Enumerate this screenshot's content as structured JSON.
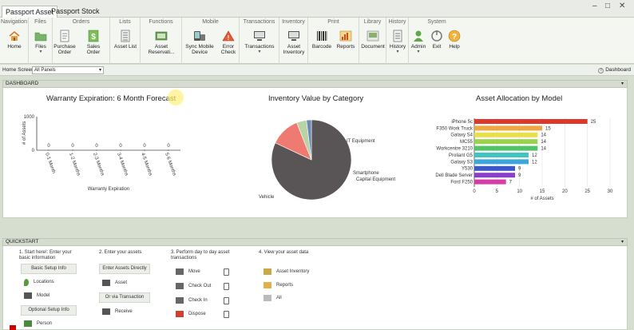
{
  "app_tabs": [
    "Passport Asset",
    "Passport Stock"
  ],
  "window_controls": [
    "–",
    "□",
    "✕"
  ],
  "ribbon": {
    "groups": [
      {
        "title": "Navigation",
        "buttons": [
          {
            "label": "Home",
            "icon": "home-icon"
          }
        ]
      },
      {
        "title": "Files",
        "buttons": [
          {
            "label": "Files",
            "icon": "folder-icon",
            "dropdown": true
          }
        ]
      },
      {
        "title": "Orders",
        "buttons": [
          {
            "label": "Purchase Order",
            "icon": "purchase-order-icon"
          },
          {
            "label": "Sales Order",
            "icon": "dollar-icon"
          }
        ]
      },
      {
        "title": "Lists",
        "buttons": [
          {
            "label": "Asset List",
            "icon": "list-icon"
          }
        ]
      },
      {
        "title": "Functions",
        "buttons": [
          {
            "label": "Asset Reservati...",
            "icon": "reservation-icon"
          }
        ]
      },
      {
        "title": "Mobile",
        "buttons": [
          {
            "label": "Sync Mobile Device",
            "icon": "sync-icon"
          },
          {
            "label": "Error Check",
            "icon": "error-icon"
          }
        ]
      },
      {
        "title": "Transactions",
        "buttons": [
          {
            "label": "Transactions",
            "icon": "monitor-icon",
            "dropdown": true
          }
        ]
      },
      {
        "title": "Inventory",
        "buttons": [
          {
            "label": "Asset Inventory",
            "icon": "monitor-icon"
          }
        ]
      },
      {
        "title": "Print",
        "buttons": [
          {
            "label": "Barcode",
            "icon": "barcode-icon"
          },
          {
            "label": "Reports",
            "icon": "reports-icon"
          }
        ]
      },
      {
        "title": "Library",
        "buttons": [
          {
            "label": "Document",
            "icon": "document-icon"
          }
        ]
      },
      {
        "title": "History",
        "buttons": [
          {
            "label": "History",
            "icon": "history-icon",
            "dropdown": true
          }
        ]
      },
      {
        "title": "System",
        "buttons": [
          {
            "label": "Admin",
            "icon": "admin-icon",
            "dropdown": true
          },
          {
            "label": "Exit",
            "icon": "power-icon"
          },
          {
            "label": "Help",
            "icon": "help-icon"
          }
        ]
      }
    ]
  },
  "viewbar": {
    "label": "Home Screen View",
    "selected": "All Panels",
    "dashboard_link": "Dashboard"
  },
  "dashboard": {
    "title": "DASHBOARD",
    "pin": "▾"
  },
  "quickstart": {
    "title": "QUICKSTART",
    "steps": [
      "1. Start here!: Enter your basic information",
      "2. Enter your assets",
      "3. Perform day to day asset transactions",
      "4. View your asset data"
    ],
    "col1": {
      "box1": "Basic Setup Info",
      "items": [
        "Locations",
        "Model"
      ],
      "box2": "Optional Setup Info",
      "items2": [
        "Person"
      ]
    },
    "col2": {
      "box1": "Enter Assets Directly",
      "items": [
        "Asset"
      ],
      "box2": "Or via Transaction",
      "items2": [
        "Receive"
      ]
    },
    "col3": {
      "items": [
        "Move",
        "Check Out",
        "Check In",
        "Dispose"
      ]
    },
    "col4": {
      "items": [
        "Asset Inventory",
        "Reports",
        "All"
      ]
    }
  },
  "chart_data": [
    {
      "type": "line",
      "title": "Warranty Expiration: 6 Month Forecast",
      "xlabel": "Warranty Expiration",
      "ylabel": "# of Assets",
      "categories": [
        "0-1 Month",
        "1-2 Months",
        "2-3 Months",
        "3-4 Months",
        "4-5 Months",
        "5-6 Months"
      ],
      "values": [
        0,
        0,
        0,
        0,
        0,
        0
      ],
      "y_tick_labels": [
        "1000",
        "0"
      ],
      "ylim": [
        0,
        1000
      ]
    },
    {
      "type": "pie",
      "title": "Inventory Value by Category",
      "slices": [
        {
          "label": "Vehicle",
          "value": 82,
          "color": "#595455"
        },
        {
          "label": "IT Equipment",
          "value": 12,
          "color": "#ef7a71"
        },
        {
          "label": "Smartphone",
          "value": 4,
          "color": "#b9d3a5"
        },
        {
          "label": "Capital Equipment",
          "value": 2,
          "color": "#6d8ab0"
        }
      ]
    },
    {
      "type": "bar",
      "orientation": "horizontal",
      "title": "Asset Allocation by Model",
      "xlabel": "# of Assets",
      "categories": [
        "iPhone 5c",
        "F350 Work Truck",
        "Galaxy S4",
        "MC55",
        "Workcentre 3210",
        "Proliant G5",
        "Galaxy S3",
        "Y530",
        "Dell Blade Server",
        "Ford F250"
      ],
      "values": [
        25,
        15,
        14,
        14,
        14,
        12,
        12,
        9,
        9,
        7
      ],
      "colors": [
        "#e0372c",
        "#f0a641",
        "#e7e04a",
        "#9bd24d",
        "#52c468",
        "#3ec4c2",
        "#3aa6dc",
        "#3b57c8",
        "#8a3fc9",
        "#d63ca5"
      ],
      "xlim": [
        0,
        30
      ],
      "x_ticks": [
        0,
        5,
        10,
        15,
        20,
        25,
        30
      ]
    }
  ]
}
